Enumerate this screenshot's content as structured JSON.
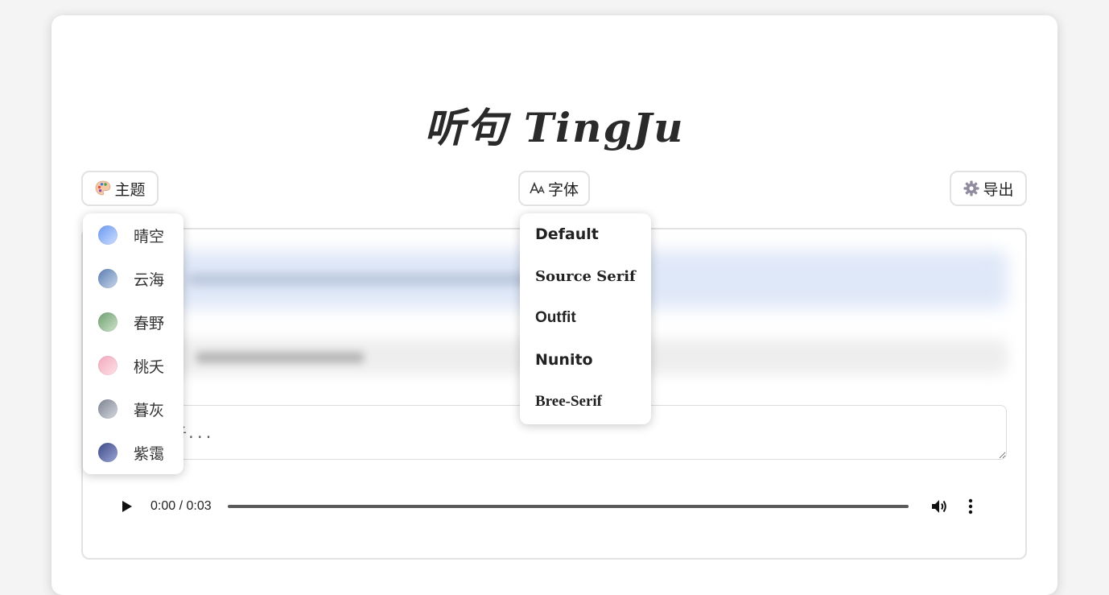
{
  "app": {
    "title": "听句 TingJu"
  },
  "toolbar": {
    "theme_label": "主题",
    "font_label": "字体",
    "export_label": "导出"
  },
  "theme_menu": {
    "items": [
      {
        "label": "晴空",
        "color_a": "#6a98f0",
        "color_b": "#cfe0ff"
      },
      {
        "label": "云海",
        "color_a": "#5a7bb0",
        "color_b": "#c9d8ec"
      },
      {
        "label": "春野",
        "color_a": "#6e9e6e",
        "color_b": "#cfe4cc"
      },
      {
        "label": "桃夭",
        "color_a": "#f2a8bb",
        "color_b": "#ffe2ea"
      },
      {
        "label": "暮灰",
        "color_a": "#7c8290",
        "color_b": "#d6d9e0"
      },
      {
        "label": "紫霭",
        "color_a": "#3e4a86",
        "color_b": "#9aa4d6"
      }
    ]
  },
  "font_menu": {
    "items": [
      "Default",
      "Source Serif",
      "Outfit",
      "Nunito",
      "Bree-Serif"
    ]
  },
  "input": {
    "placeholder": "，听写句子..."
  },
  "audio": {
    "time": "0:00 / 0:03",
    "progress": 0
  }
}
